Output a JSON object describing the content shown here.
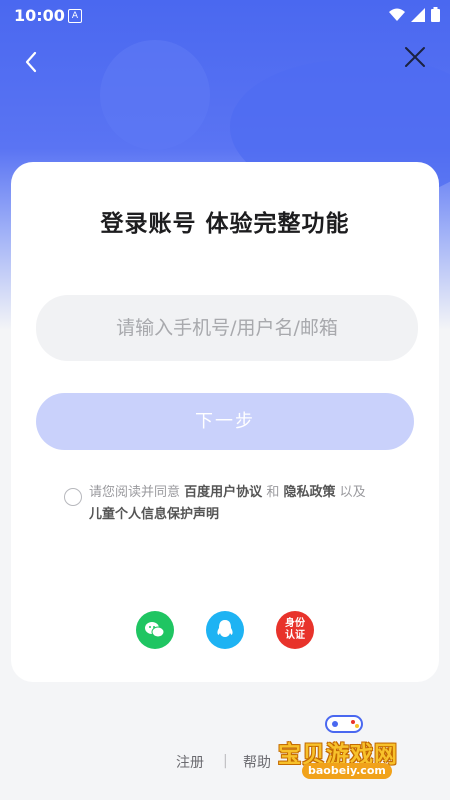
{
  "status": {
    "time": "10:00",
    "notify_glyph": "A"
  },
  "nav": {
    "back_icon": "back-chevron-icon",
    "close_icon": "close-icon"
  },
  "login": {
    "title": "登录账号 体验完整功能",
    "input_placeholder": "请输入手机号/用户名/邮箱",
    "input_value": "",
    "next_label": "下一步"
  },
  "agreement": {
    "prefix": "请您阅读并同意",
    "link1": "百度用户协议",
    "and": "和",
    "link2": "隐私政策",
    "also": "以及",
    "link3": "儿童个人信息保护声明"
  },
  "social": {
    "wechat_icon": "wechat-icon",
    "qq_icon": "qq-icon",
    "id_label": "身份认证"
  },
  "footer": {
    "register": "注册",
    "separator": "|",
    "help": "帮助"
  },
  "watermark": {
    "brand": "宝贝游戏网",
    "url": "baobeiy.com"
  },
  "colors": {
    "primary": "#4a68f0",
    "button_disabled": "#c9d1fb",
    "wechat": "#1fc562",
    "qq": "#1eb3f3",
    "id_red": "#e8332b"
  }
}
